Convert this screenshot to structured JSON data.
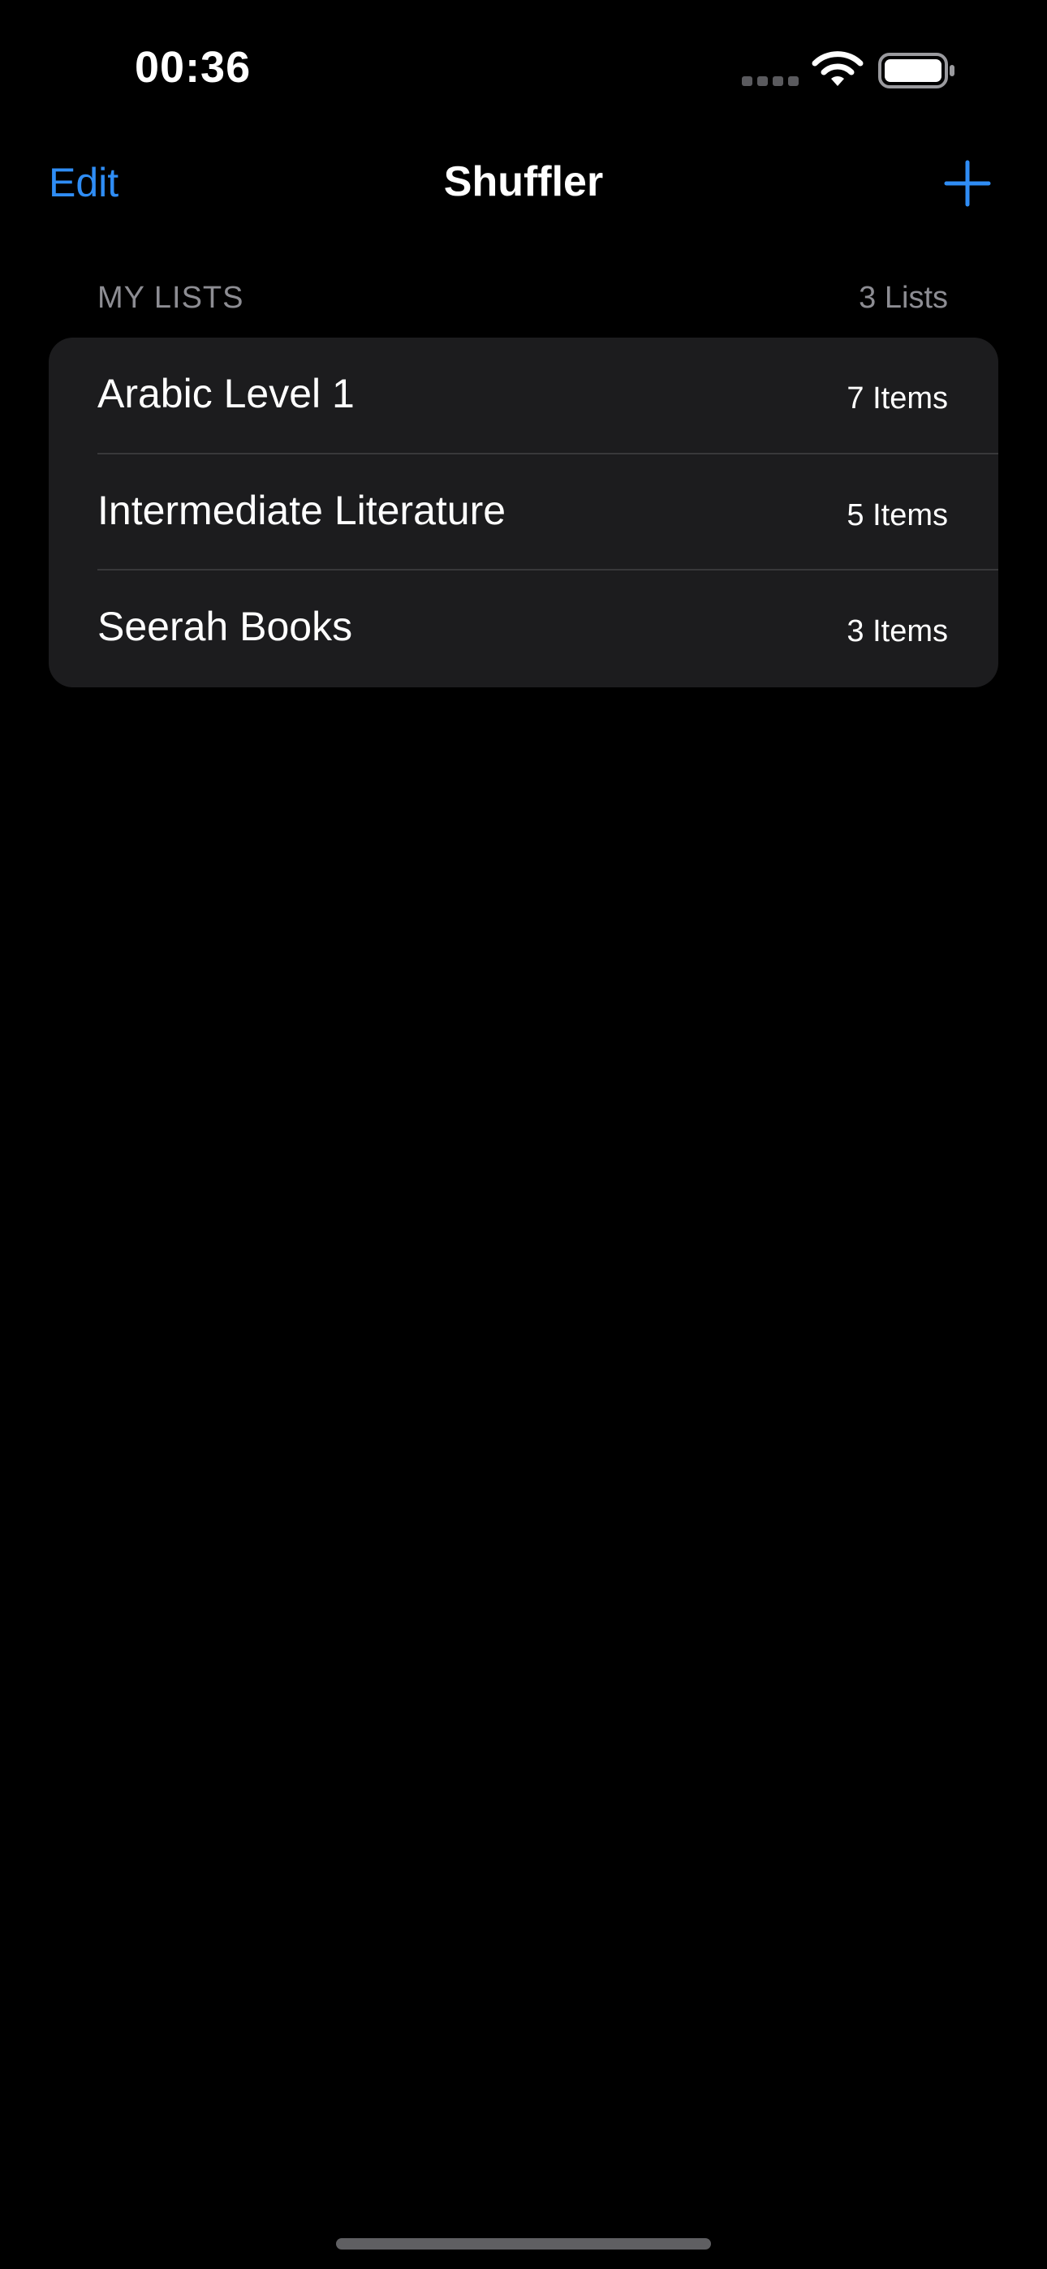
{
  "status_bar": {
    "time": "00:36",
    "icons": [
      "cellular-signal-icon",
      "wifi-icon",
      "battery-icon"
    ]
  },
  "nav": {
    "edit_label": "Edit",
    "title": "Shuffler",
    "add_icon": "plus-icon"
  },
  "section": {
    "title": "MY LISTS",
    "count": "3 Lists"
  },
  "lists": [
    {
      "title": "Arabic Level 1",
      "count": "7 Items"
    },
    {
      "title": "Intermediate Literature",
      "count": "5 Items"
    },
    {
      "title": "Seerah Books",
      "count": "3 Items"
    }
  ],
  "colors": {
    "background": "#000000",
    "accent": "#2f8df5",
    "card": "#1c1c1e",
    "secondary_text": "#8d8d93",
    "separator": "#38383a"
  }
}
